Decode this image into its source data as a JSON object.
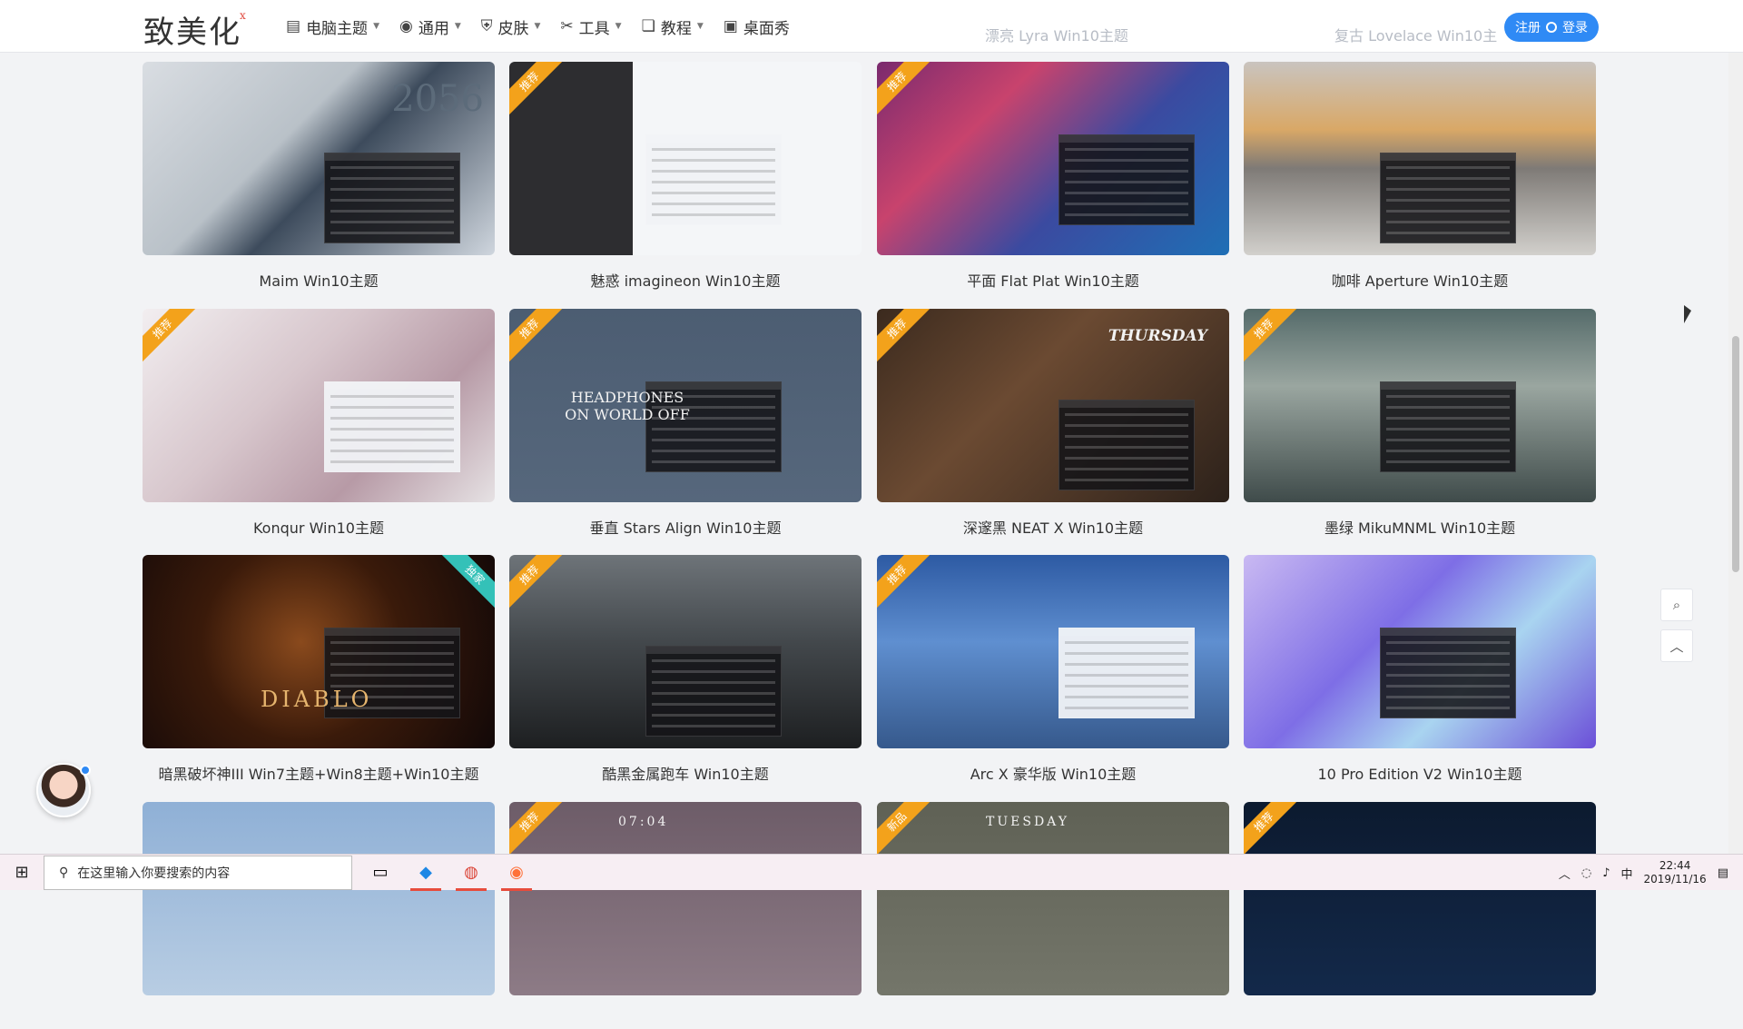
{
  "header": {
    "logo": "致美化",
    "logo_mark": "x",
    "nav": [
      {
        "icon": "monitor-icon",
        "glyph": "▤",
        "label": "电脑主题"
      },
      {
        "icon": "target-icon",
        "glyph": "◉",
        "label": "通用"
      },
      {
        "icon": "shirt-icon",
        "glyph": "⛨",
        "label": "皮肤"
      },
      {
        "icon": "tools-icon",
        "glyph": "✂",
        "label": "工具"
      },
      {
        "icon": "book-icon",
        "glyph": "❏",
        "label": "教程"
      },
      {
        "icon": "desktop-icon",
        "glyph": "▣",
        "label": "桌面秀"
      }
    ],
    "ghost_titles": [
      "漂亮 Lyra Win10主题",
      "复古 Lovelace Win10主"
    ],
    "auth": {
      "register": "注册",
      "login": "登录"
    }
  },
  "cards": [
    {
      "title": "Maim Win10主题",
      "badge": "",
      "bg": "linear-gradient(135deg,#d9dde2 0%,#b9c1c8 40%,#3d4b5c 55%,#cfd6de 100%)",
      "overlay": "2056"
    },
    {
      "title": "魅惑 imagineon Win10主题",
      "badge": "推荐",
      "bg": "linear-gradient(90deg,#2d2d30 0 35%,#f4f6f8 35%)",
      "overlay": ""
    },
    {
      "title": "平面 Flat Plat Win10主题",
      "badge": "推荐",
      "bg": "linear-gradient(135deg,#7a2a6e 0%,#c8436d 30%,#3b4aa0 60%,#1f6fb5 100%)",
      "overlay": ""
    },
    {
      "title": "咖啡 Aperture Win10主题",
      "badge": "",
      "bg": "linear-gradient(180deg,#c9c4bf 0%,#d9a867 35%,#7e7a76 55%,#d2d0cc 100%)",
      "overlay": ""
    },
    {
      "title": "Konqur Win10主题",
      "badge": "推荐",
      "bg": "linear-gradient(135deg,#f2eef0 0%,#d7c6cc 40%,#b79aa6 70%,#e6e2e4 100%)",
      "overlay": ""
    },
    {
      "title": "垂直 Stars Align Win10主题",
      "badge": "推荐",
      "bg": "linear-gradient(180deg,#4c5d72 0%,#56677c 100%)",
      "overlay": "HEADPHONES ON WORLD OFF"
    },
    {
      "title": "深邃黑 NEAT X Win10主题",
      "badge": "推荐",
      "bg": "linear-gradient(135deg,#3b2a1e 0%,#6b4a32 40%,#2c211a 100%)",
      "overlay": "THURSDAY"
    },
    {
      "title": "墨绿 MikuMNML Win10主题",
      "badge": "推荐",
      "bg": "linear-gradient(180deg,#556b6a 0%,#9aa6a0 40%,#3f4b4a 100%)",
      "overlay": ""
    },
    {
      "title": "暗黑破坏神III Win7主题+Win8主题+Win10主题",
      "badge": "独家",
      "bg": "radial-gradient(circle at 45% 45%,#8a4a1d 0%,#3a1a0a 45%,#120808 100%)",
      "overlay": "DIABLO"
    },
    {
      "title": "酷黑金属跑车 Win10主题",
      "badge": "推荐",
      "bg": "linear-gradient(180deg,#6e7479 0%,#43484c 45%,#1d1f21 100%)",
      "overlay": ""
    },
    {
      "title": "Arc X 豪华版 Win10主题",
      "badge": "推荐",
      "bg": "linear-gradient(180deg,#2d5aa3 0%,#5f8fd0 45%,#36598c 100%)",
      "overlay": ""
    },
    {
      "title": "10 Pro Edition V2 Win10主题",
      "badge": "",
      "bg": "linear-gradient(135deg,#c9b9f2 0%,#7e6ee6 40%,#a9d4f0 65%,#6b4fd8 100%)",
      "overlay": ""
    },
    {
      "title": "",
      "badge": "",
      "bg": "linear-gradient(180deg,#8fb0d6 0%,#b8cde3 100%)",
      "overlay": ""
    },
    {
      "title": "",
      "badge": "推荐",
      "bg": "linear-gradient(180deg,#6d5c68 0%,#8d7b86 100%)",
      "overlay": "07:04"
    },
    {
      "title": "",
      "badge": "新品",
      "bg": "linear-gradient(180deg,#5f6155 0%,#74766a 100%)",
      "overlay": "TUESDAY"
    },
    {
      "title": "",
      "badge": "推荐",
      "bg": "linear-gradient(180deg,#0c1a2f 0%,#13294a 100%)",
      "overlay": ""
    }
  ],
  "side": {
    "search_icon": "⌕",
    "top_icon": "︿"
  },
  "taskbar": {
    "search_placeholder": "在这里输入你要搜索的内容",
    "time": "22:44",
    "date": "2019/11/16",
    "ime": "中"
  }
}
